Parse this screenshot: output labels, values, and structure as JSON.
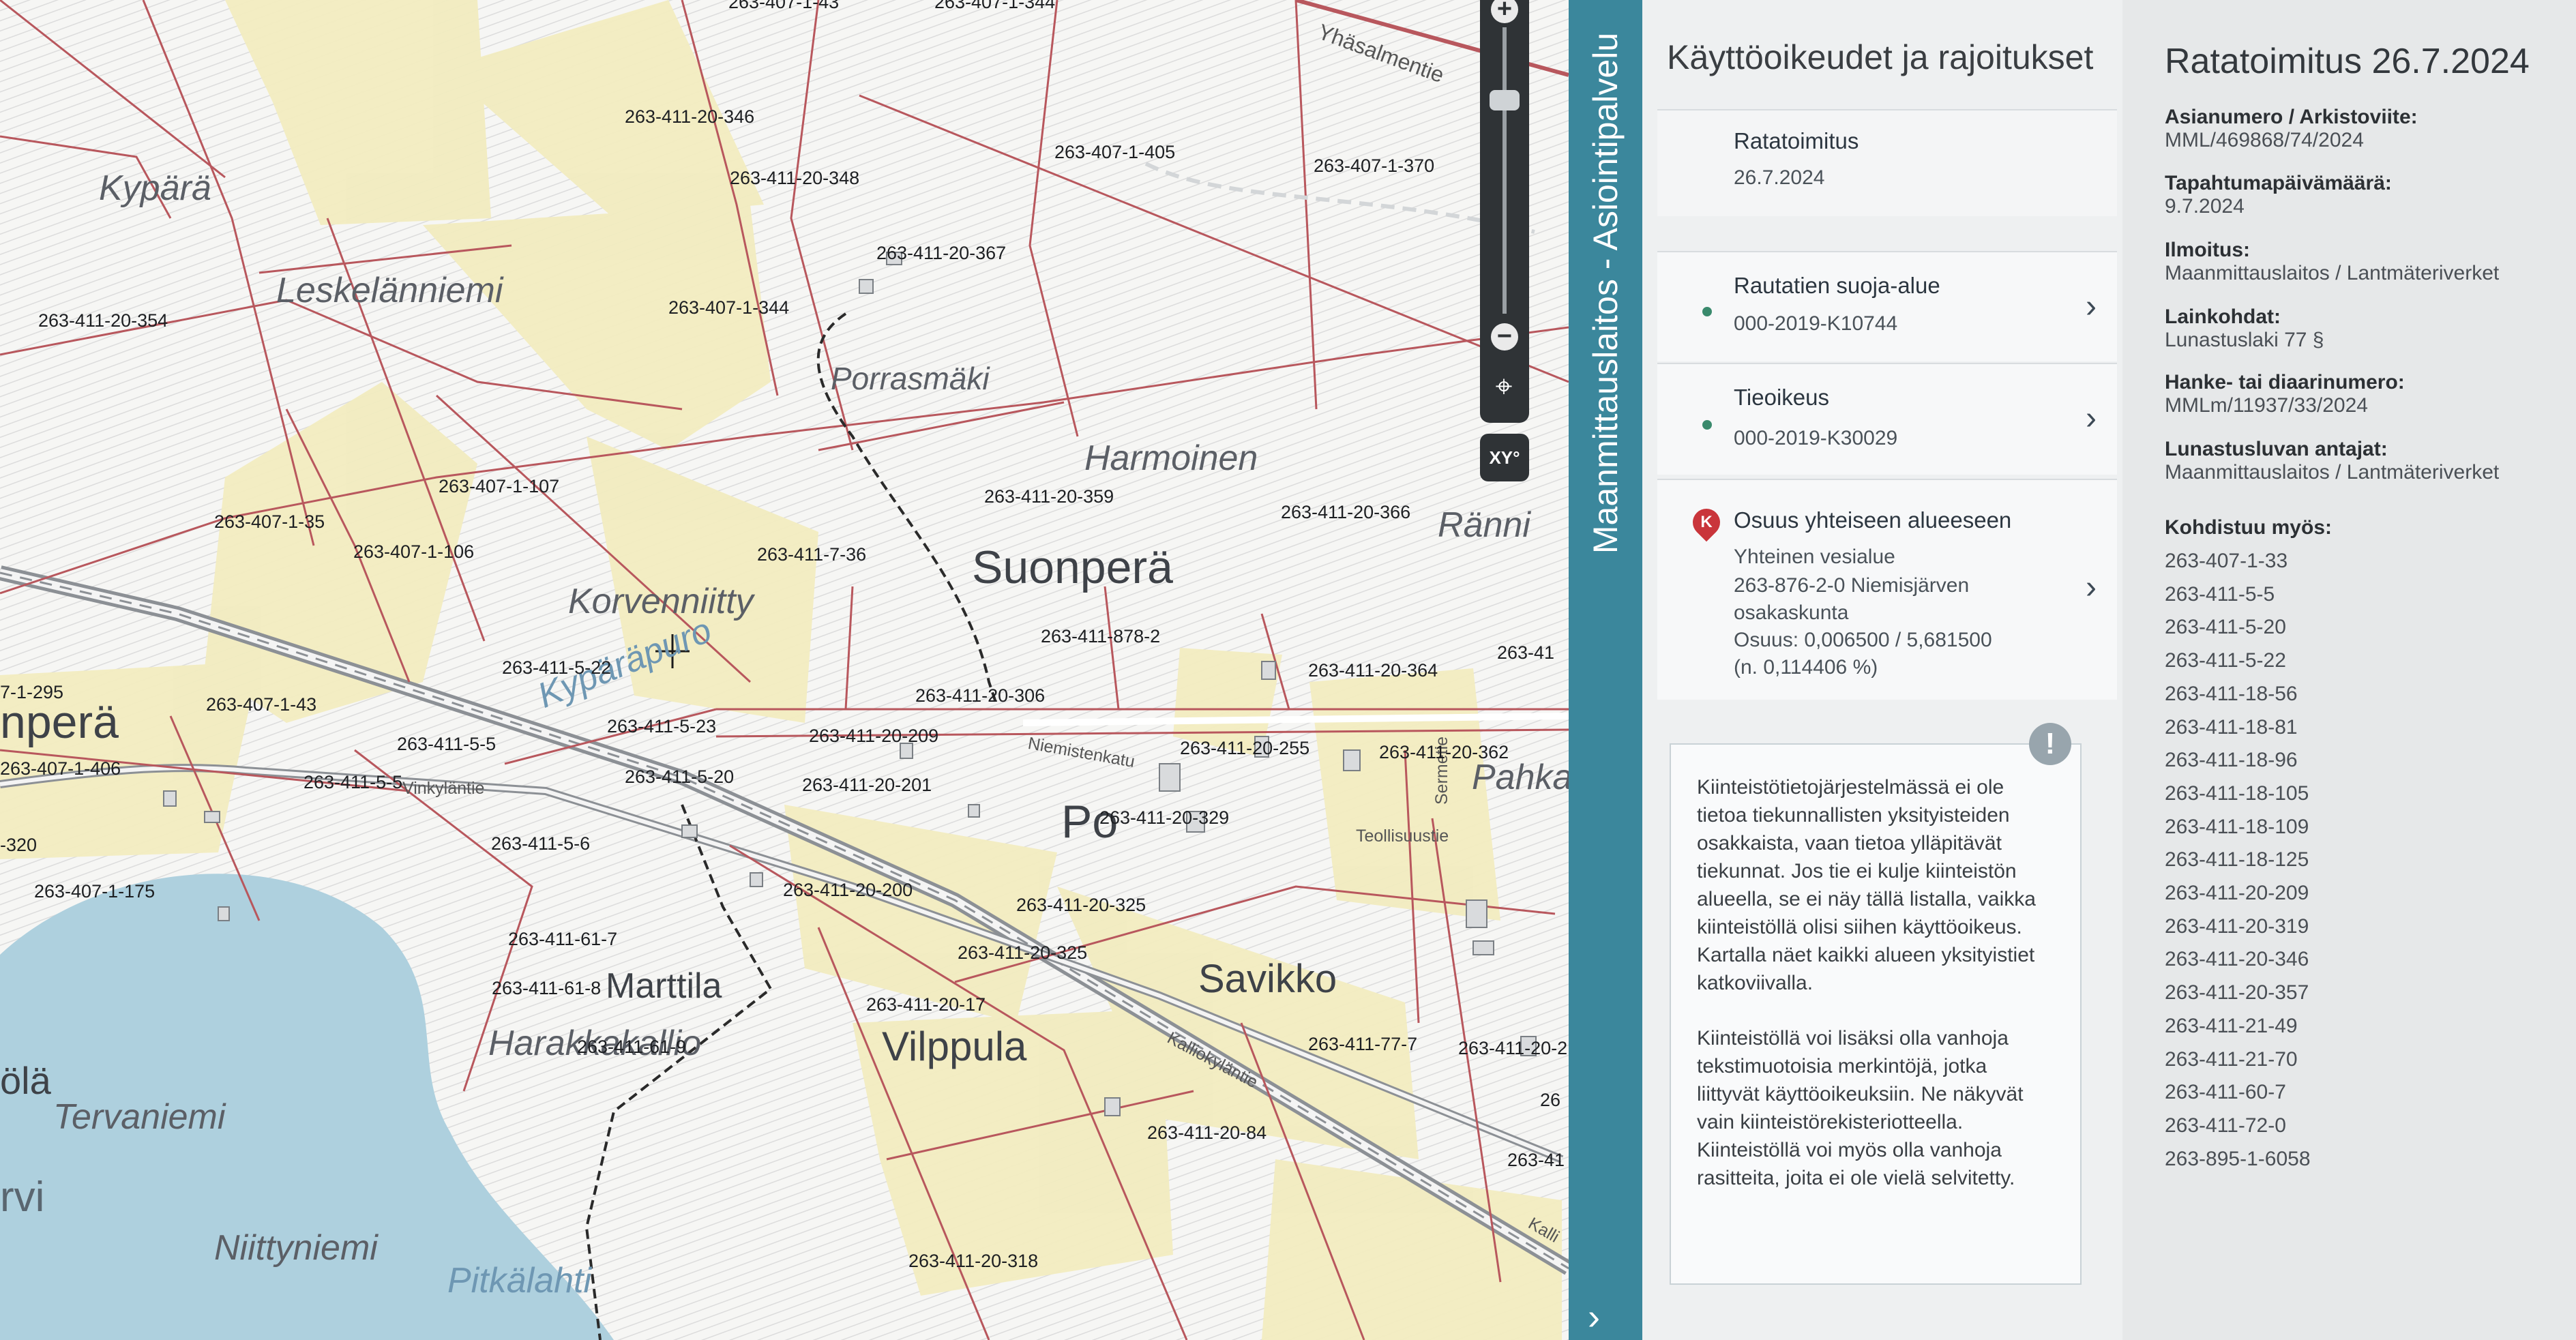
{
  "map": {
    "place_names": [
      {
        "text": "Kypärä",
        "cls": "place"
      },
      {
        "text": "Leskelänniemi",
        "cls": "place"
      },
      {
        "text": "Porrasmäki",
        "cls": "place mid"
      },
      {
        "text": "Harmoinen",
        "cls": "place"
      },
      {
        "text": "Suonperä",
        "cls": "place big"
      },
      {
        "text": "Ränni",
        "cls": "place"
      },
      {
        "text": "Korvenniitty",
        "cls": "place"
      },
      {
        "text": "Kypäräpuro",
        "cls": "place"
      },
      {
        "text": "nperä",
        "cls": "place big"
      },
      {
        "text": "Pahka",
        "cls": "place"
      },
      {
        "text": "Po",
        "cls": "place big"
      },
      {
        "text": "Savikko",
        "cls": "place big"
      },
      {
        "text": "Marttila",
        "cls": "place big"
      },
      {
        "text": "Harakkakallio",
        "cls": "place"
      },
      {
        "text": "Vilppula",
        "cls": "place big"
      },
      {
        "text": "ölä",
        "cls": "place big"
      },
      {
        "text": "Tervaniemi",
        "cls": "place"
      },
      {
        "text": "rvi",
        "cls": "place big"
      },
      {
        "text": "Niittyniemi",
        "cls": "place"
      },
      {
        "text": "Pitkälahti",
        "cls": "place"
      }
    ],
    "road_names": [
      "Yhäsalmentie",
      "Niemistenkatu",
      "Vinkyläntie",
      "Teollisuustie",
      "Sermetie",
      "Kalliokyläntie",
      "Kalli"
    ],
    "parcels": [
      "263-407-1-43",
      "263-407-1-344",
      "263-411-20-346",
      "263-407-1-405",
      "263-407-1-370",
      "263-411-20-348",
      "263-411-20-367",
      "263-411-20-354",
      "263-407-1-344",
      "263-407-1-107",
      "263-411-20-359",
      "263-411-20-366",
      "263-407-1-35",
      "263-407-1-106",
      "263-411-7-36",
      "263-411-878-2",
      "263-411-5-22",
      "263-411-20-364",
      "263-41",
      "7-1-295",
      "263-407-1-43",
      "263-411-5-23",
      "263-411-20-306",
      "263-411-20-209",
      "263-411-5-5",
      "263-411-20-255",
      "263-411-20-362",
      "263-407-1-406",
      "263-411-5-5",
      "263-411-5-20",
      "263-411-20-201",
      "263-411-20-329",
      "-320",
      "263-411-5-6",
      "263-411-20-200",
      "263-411-20-325",
      "263-407-1-175",
      "263-411-61-7",
      "263-411-20-325",
      "263-411-61-8",
      "263-411-20-17",
      "263-411-61-9",
      "263-411-77-7",
      "263-411-20-2",
      "26",
      "263-411-20-84",
      "263-41",
      "263-411-20-318"
    ],
    "controls": {
      "zoom_in": "+",
      "zoom_out": "−",
      "locate": "⌖",
      "xy": "XY°"
    }
  },
  "side_tab": {
    "label": "Maanmittauslaitos - Asiointipalvelu",
    "chevron": "›"
  },
  "middle": {
    "title": "Käyttöoikeudet ja rajoitukset",
    "selected": {
      "title": "Ratatoimitus",
      "date": "26.7.2024"
    },
    "items": [
      {
        "title": "Rautatien suoja-alue",
        "id": "000-2019-K10744"
      },
      {
        "title": "Tieoikeus",
        "id": "000-2019-K30029"
      }
    ],
    "share": {
      "title": "Osuus yhteiseen alueeseen",
      "line1": "Yhteinen vesialue",
      "line2": "263-876-2-0 Niemisjärven",
      "line3": "osakaskunta",
      "line4": "Osuus: 0,006500 / 5,681500",
      "line5": "(n. 0,114406 %)",
      "marker": "K"
    },
    "info_para1": "Kiinteistötietojärjestelmässä ei ole tietoa tiekunnallisten yksityisteiden osakkaista, vaan tietoa ylläpitävät tiekunnat. Jos tie ei kulje kiinteistön alueella, se ei näy tällä listalla, vaikka kiinteistöllä olisi siihen käyttöoikeus. Kartalla näet kaikki alueen yksityistiet katkoviivalla.",
    "info_para2": "Kiinteistöllä voi lisäksi olla vanhoja tekstimuotoisia merkintöjä, jotka liittyvät käyttöoikeuksiin. Ne näkyvät vain kiinteistörekisteriotteella. Kiinteistöllä voi myös olla vanhoja rasitteita, joita ei ole vielä selvitetty.",
    "info_badge": "!"
  },
  "right": {
    "title": "Ratatoimitus 26.7.2024",
    "fields": [
      {
        "k": "Asianumero / Arkistoviite:",
        "v": "MML/469868/74/2024"
      },
      {
        "k": "Tapahtumapäivämäärä:",
        "v": "9.7.2024"
      },
      {
        "k": "Ilmoitus:",
        "v": "Maanmittauslaitos / Lantmäteriverket"
      },
      {
        "k": "Lainkohdat:",
        "v": "Lunastuslaki 77 §"
      },
      {
        "k": "Hanke- tai diaarinumero:",
        "v": "MMLm/11937/33/2024"
      },
      {
        "k": "Lunastusluvan antajat:",
        "v": "Maanmittauslaitos / Lantmäteriverket"
      }
    ],
    "also_label": "Kohdistuu myös:",
    "also": [
      "263-407-1-33",
      "263-411-5-5",
      "263-411-5-20",
      "263-411-5-22",
      "263-411-18-56",
      "263-411-18-81",
      "263-411-18-96",
      "263-411-18-105",
      "263-411-18-109",
      "263-411-18-125",
      "263-411-20-209",
      "263-411-20-319",
      "263-411-20-346",
      "263-411-20-357",
      "263-411-21-49",
      "263-411-21-70",
      "263-411-60-7",
      "263-411-72-0",
      "263-895-1-6058"
    ]
  },
  "colors": {
    "tab": "#3b879c",
    "parcel_line": "#b8575d",
    "field": "#f2ecc0",
    "lake": "#aed0de",
    "rail": "#9a9ea3"
  }
}
